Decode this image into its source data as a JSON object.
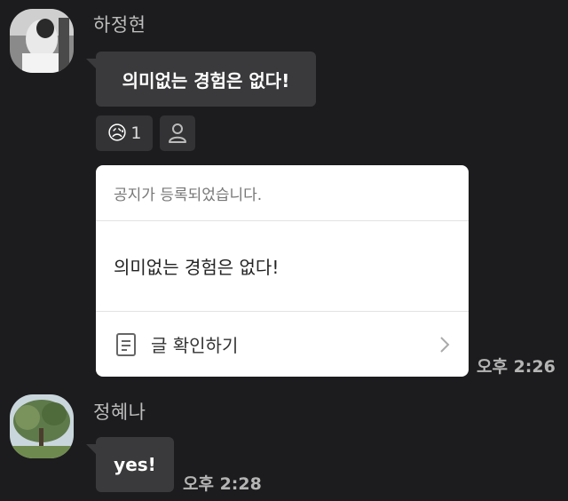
{
  "messages": [
    {
      "sender": "하정현",
      "text": "의미없는 경험은 없다!",
      "reaction": {
        "emoji": "😥",
        "count": "1"
      }
    },
    {
      "notice_header": "공지가 등록되었습니다.",
      "notice_body": "의미없는 경험은 없다!",
      "notice_action": "글 확인하기",
      "time": "오후 2:26"
    },
    {
      "sender": "정혜나",
      "text": "yes!",
      "time": "오후 2:28"
    }
  ],
  "icons": {
    "reaction_add": "person-icon",
    "notice_doc": "document-icon",
    "notice_chevron": "chevron-right-icon"
  },
  "colors": {
    "background": "#1c1c1e",
    "bubble": "#3a3a3c",
    "notice_card": "#ffffff"
  }
}
